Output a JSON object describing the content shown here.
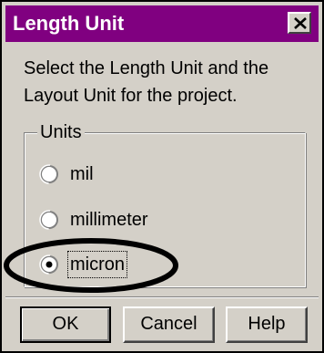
{
  "window": {
    "title": "Length Unit",
    "close_icon": "close-x-icon",
    "colors": {
      "titlebar": "#800080",
      "face": "#d4d0c8"
    }
  },
  "instructions": "Select the Length Unit and the Layout Unit for the project.",
  "units_group": {
    "label": "Units",
    "options": [
      {
        "label": "mil",
        "selected": false
      },
      {
        "label": "millimeter",
        "selected": false
      },
      {
        "label": "micron",
        "selected": true
      }
    ]
  },
  "buttons": {
    "ok": "OK",
    "cancel": "Cancel",
    "help": "Help"
  }
}
